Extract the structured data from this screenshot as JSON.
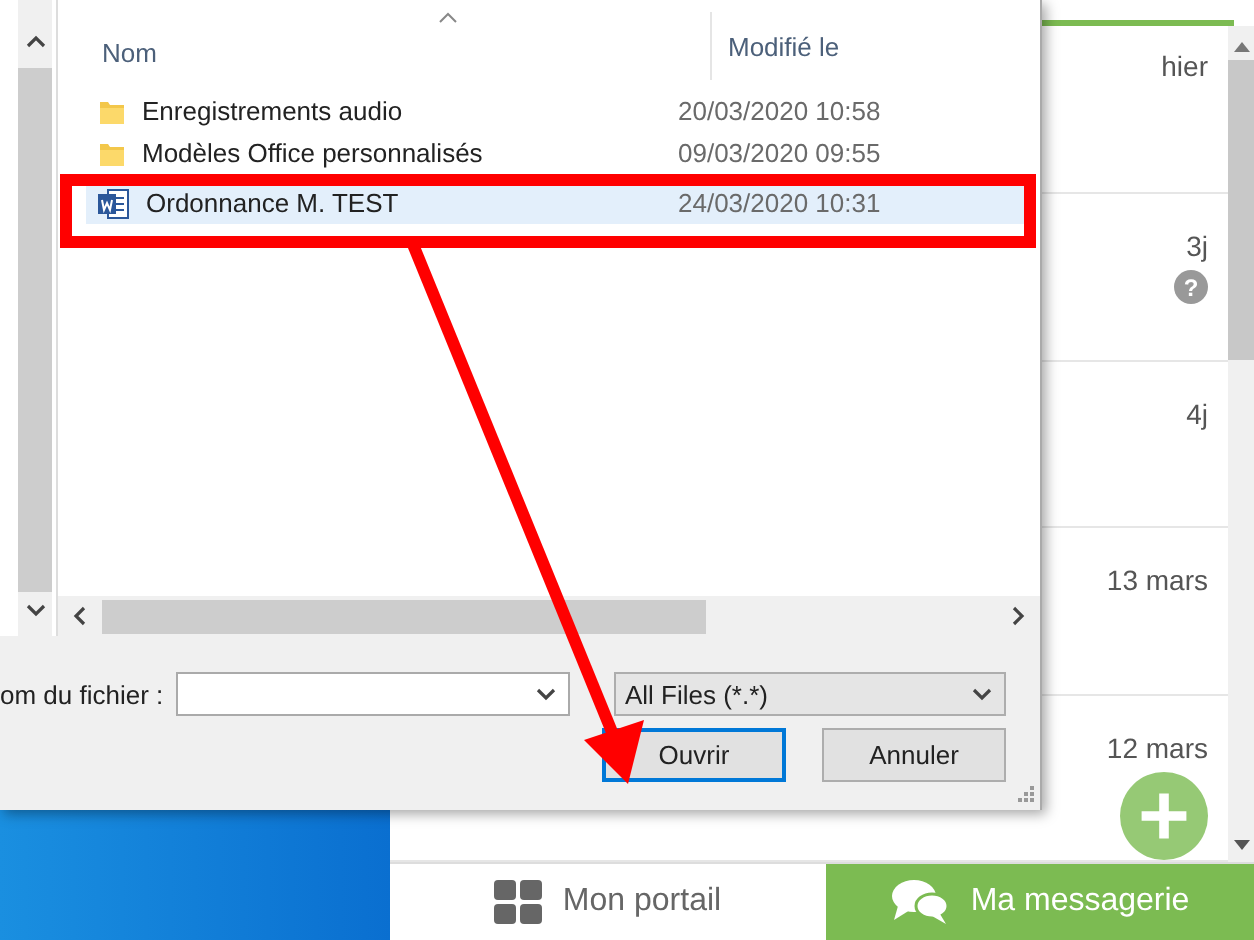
{
  "background_app": {
    "messages": [
      {
        "date": "hier"
      },
      {
        "date": "3j",
        "badge": "?"
      },
      {
        "date": "4j"
      },
      {
        "date": "13 mars"
      },
      {
        "date": "12 mars"
      }
    ],
    "nav": [
      {
        "label": "Mon portail",
        "selected": false,
        "kind": "grid"
      },
      {
        "label": "Ma messagerie",
        "selected": true,
        "kind": "chat"
      }
    ]
  },
  "dialog": {
    "columns": [
      "Nom",
      "Modifié le"
    ],
    "files": [
      {
        "kind": "folder",
        "name": "Enregistrements audio",
        "modified": "20/03/2020 10:58",
        "selected": false
      },
      {
        "kind": "folder",
        "name": "Modèles Office personnalisés",
        "modified": "09/03/2020 09:55",
        "selected": false
      },
      {
        "kind": "word",
        "name": "Ordonnance M. TEST",
        "modified": "24/03/2020 10:31",
        "selected": true
      }
    ],
    "filename_label": "om du fichier :",
    "filter": "All Files (*.*)",
    "buttons": [
      {
        "label": "Ouvrir",
        "focused": true
      },
      {
        "label": "Annuler",
        "focused": false
      }
    ]
  }
}
